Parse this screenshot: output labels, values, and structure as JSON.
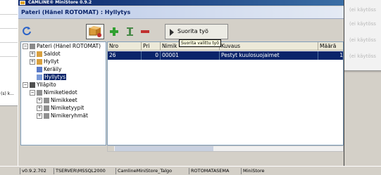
{
  "background_left": {
    "text": "(s) k..."
  },
  "background_right": {
    "items": [
      "(ei käytöss",
      "(ei käytöss",
      "(ei käytöss",
      "(ei käytöss"
    ]
  },
  "window": {
    "title": "CAMLINE® MiniStore 0.9.2"
  },
  "header": {
    "title": "Pateri (Hänel ROTOMAT) : Hyllytys"
  },
  "toolbar": {
    "run_label": "Suorita työ",
    "tooltip": "Suorita valittu työ"
  },
  "tree": {
    "root": "Pateri (Hänel ROTOMAT)",
    "saldot": "Saldot",
    "hyllyt": "Hyllyt",
    "kerailly": "Keräily",
    "hyllytys": "Hyllytys",
    "yllapito": "Ylläpito",
    "nimiketiedot": "Nimiketiedot",
    "nimikkeet": "Nimikkeet",
    "nimiketyypit": "Nimiketyypit",
    "nimikeryhmat": "Nimikeryhmät"
  },
  "grid": {
    "columns": [
      "Nro",
      "Pri",
      "Nimik",
      "Kuvaus",
      "Määrä"
    ],
    "rows": [
      [
        "26",
        "0",
        "00001",
        "Pestyt kuulosuojaimet",
        "1"
      ]
    ]
  },
  "statusbar": {
    "version": "v0.9.2.702",
    "server": "TSERVER\\MSSQL2000",
    "database": "CamlineMiniStore_Talgo",
    "station": "ROTOMATASEMA",
    "app": "MiniStore"
  },
  "colors": {
    "selection": "#0a246a",
    "header_gradient_start": "#b8c8e8",
    "titlebar": "#0a246a"
  },
  "icons": [
    "refresh-icon",
    "shelf-icon",
    "add-icon",
    "edit-icon",
    "delete-icon",
    "play-icon",
    "folder-icon",
    "tools-icon"
  ]
}
